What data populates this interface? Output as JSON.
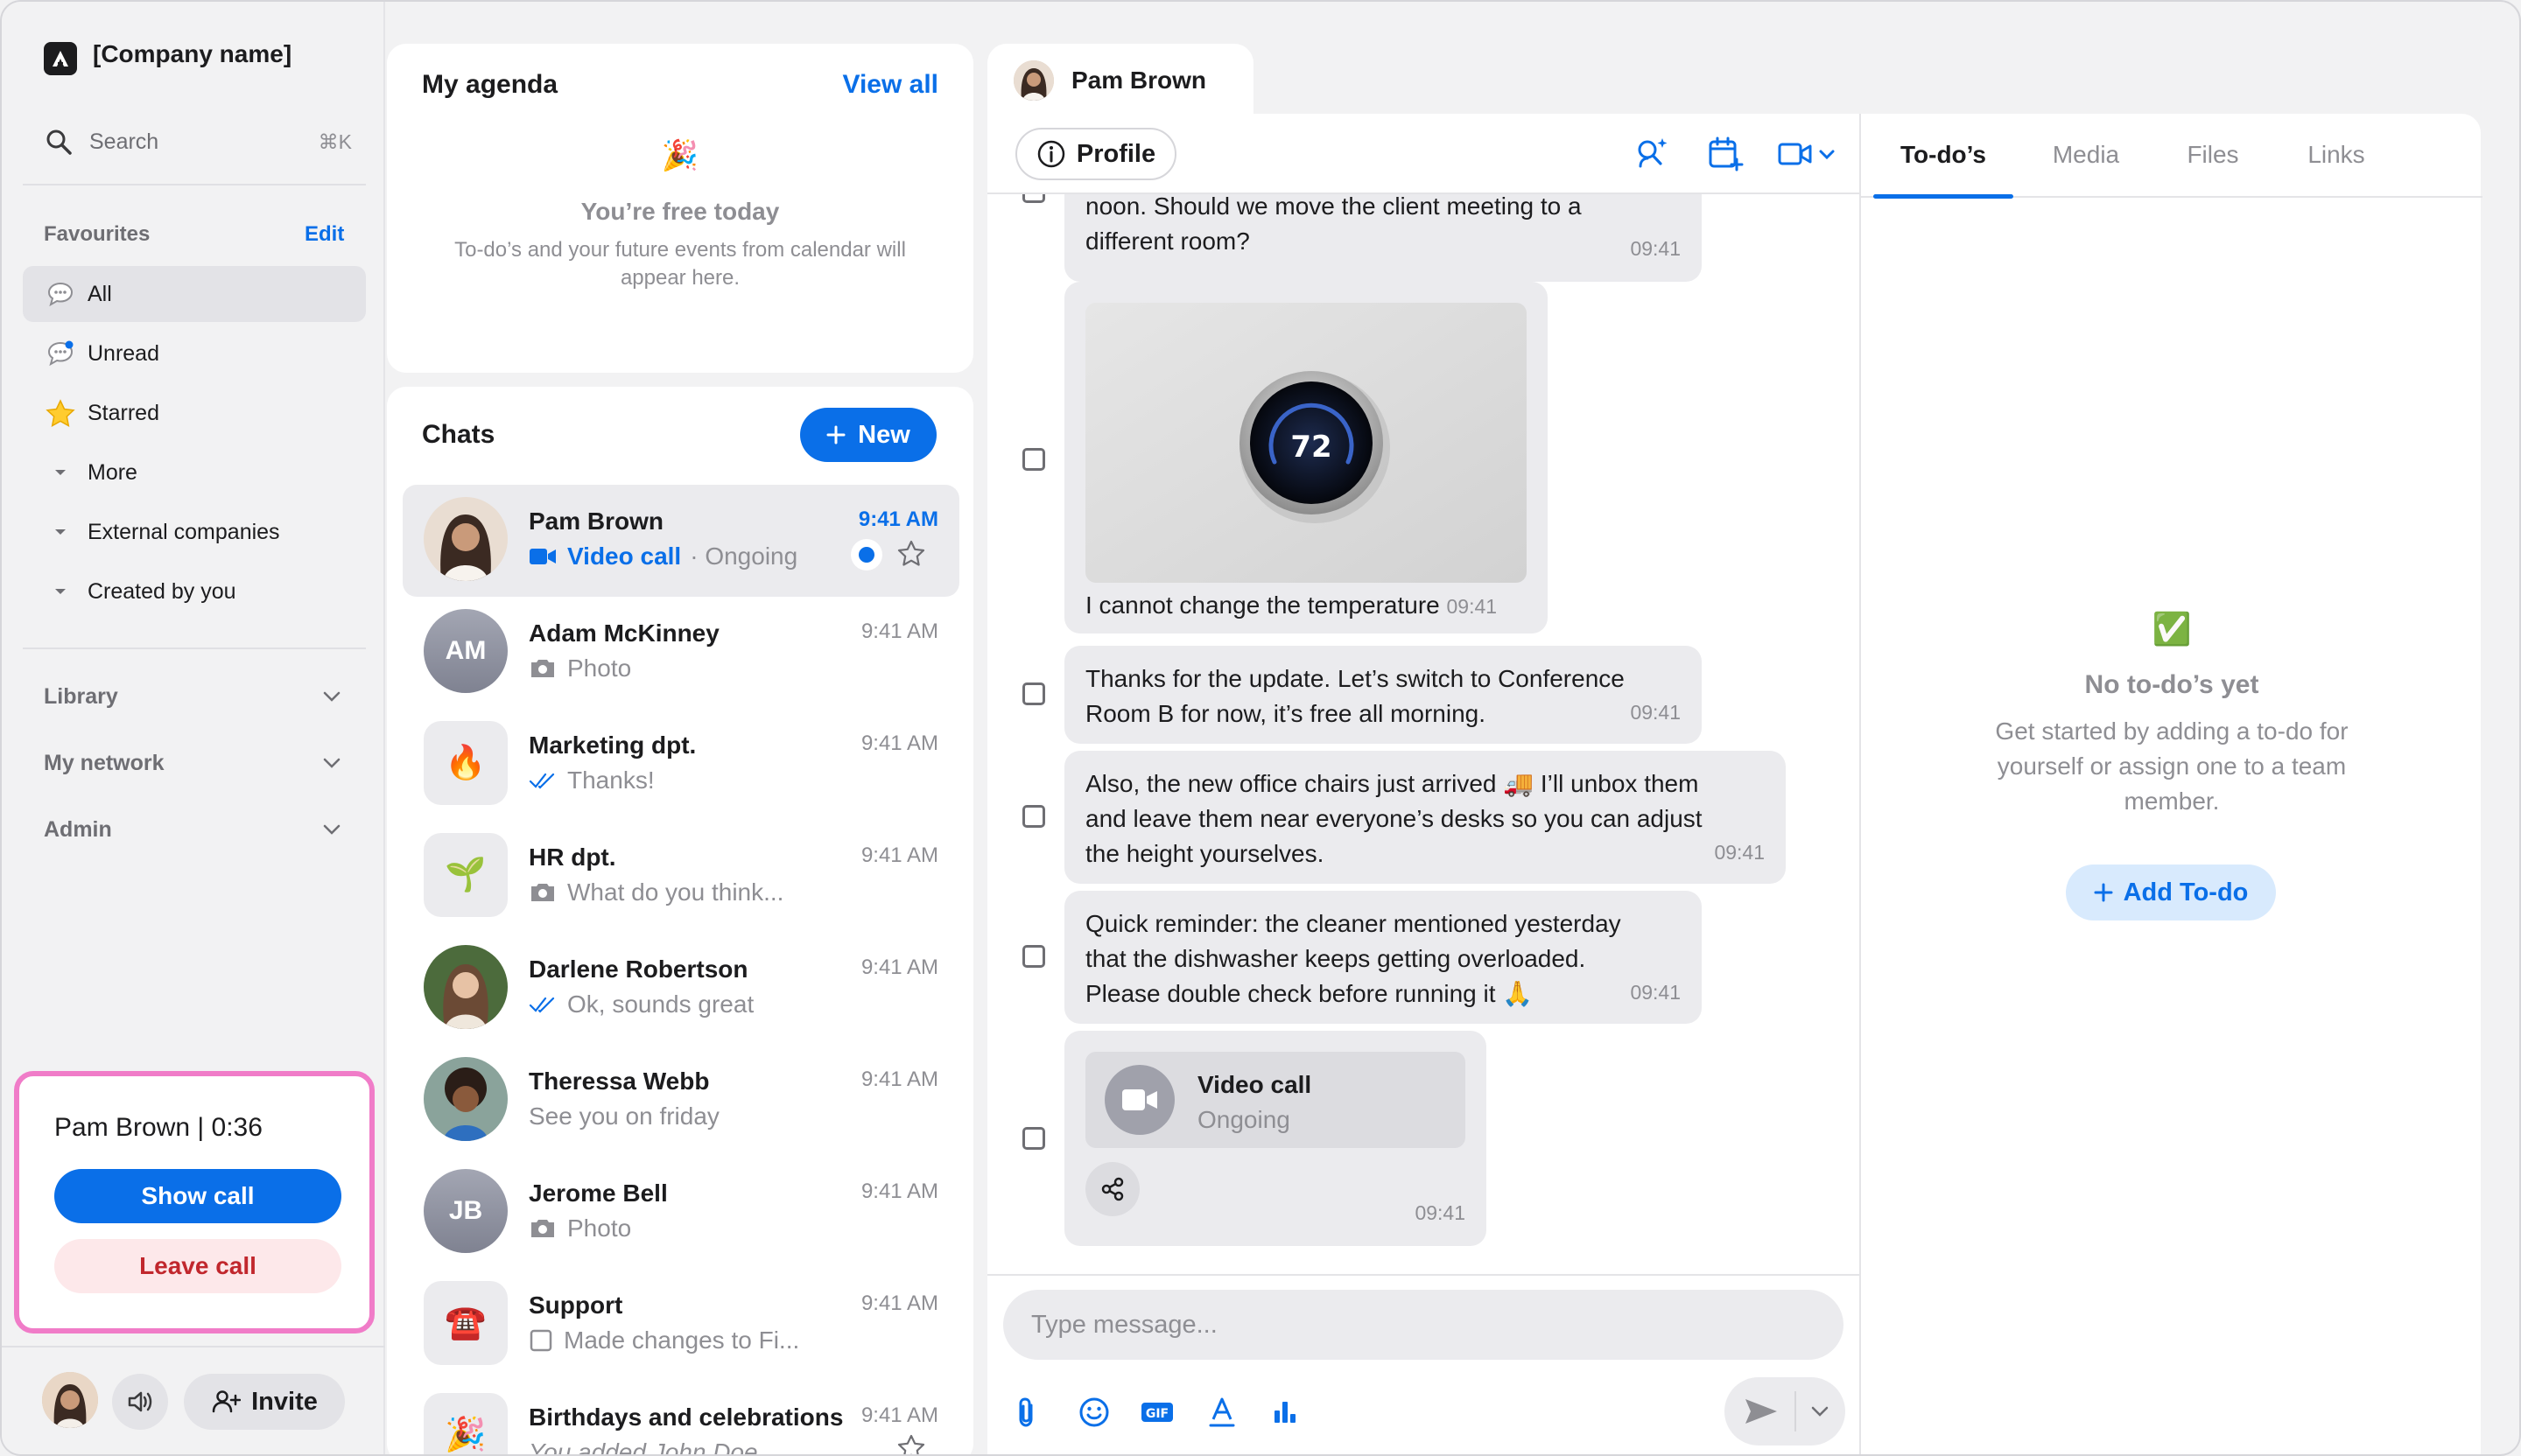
{
  "app": {
    "company": "[Company name]"
  },
  "sidebar": {
    "search_label": "Search",
    "search_shortcut": "⌘K",
    "favourites_title": "Favourites",
    "favourites_edit": "Edit",
    "items": [
      {
        "label": "All",
        "icon": "chat-bubble-icon"
      },
      {
        "label": "Unread",
        "icon": "unread-bubble-icon"
      },
      {
        "label": "Starred",
        "icon": "star-icon"
      },
      {
        "label": "More",
        "icon": "caret-down-icon"
      },
      {
        "label": "External companies",
        "icon": "caret-down-icon"
      },
      {
        "label": "Created by you",
        "icon": "caret-down-icon"
      }
    ],
    "sections": [
      {
        "label": "Library"
      },
      {
        "label": "My network"
      },
      {
        "label": "Admin"
      }
    ],
    "call": {
      "title": "Pam Brown | 0:36",
      "show_label": "Show call",
      "leave_label": "Leave call"
    },
    "invite_label": "Invite"
  },
  "agenda": {
    "title": "My agenda",
    "view_all": "View all",
    "free_icon": "🎉",
    "free_title": "You’re free today",
    "free_desc_1": "To-do’s and your future events from calendar will",
    "free_desc_2": "appear here."
  },
  "chats": {
    "title": "Chats",
    "new_label": "New",
    "rows": [
      {
        "name": "Pam Brown",
        "sub_link": "Video call",
        "sub": "· Ongoing",
        "time": "9:41 AM"
      },
      {
        "name": "Adam McKinney",
        "initials": "AM",
        "sub": "Photo",
        "time": "9:41 AM"
      },
      {
        "name": "Marketing dpt.",
        "emoji": "🔥",
        "sub": "Thanks!",
        "time": "9:41 AM"
      },
      {
        "name": "HR dpt.",
        "emoji": "🌱",
        "sub": "What do you think...",
        "time": "9:41 AM"
      },
      {
        "name": "Darlene Robertson",
        "sub": "Ok, sounds great",
        "time": "9:41 AM"
      },
      {
        "name": "Theressa Webb",
        "sub": "See you on friday",
        "time": "9:41 AM"
      },
      {
        "name": "Jerome Bell",
        "initials": "JB",
        "sub": "Photo",
        "time": "9:41 AM"
      },
      {
        "name": "Support",
        "emoji": "☎️",
        "sub": "Made changes to Fi...",
        "time": "9:41 AM"
      },
      {
        "name": "Birthdays and celebrations",
        "emoji": "🎉",
        "sub": "You added John Doe",
        "time": "9:41 AM"
      }
    ]
  },
  "conversation": {
    "tab_name": "Pam Brown",
    "profile_label": "Profile",
    "messages": [
      {
        "line1": "noon. Should we move the client meeting to a",
        "line2": "different room?",
        "time": "09:41"
      },
      {
        "caption": "I cannot change the temperature",
        "time": "09:41",
        "thermostat": "72"
      },
      {
        "line1": "Thanks for the update. Let’s switch to Conference",
        "line2": "Room B for now, it’s free all morning.",
        "time": "09:41"
      },
      {
        "line1": "Also, the new office chairs just arrived 🚚 I’ll unbox them",
        "line2": "and leave them near everyone’s desks so you can adjust",
        "line3": "the height yourselves.",
        "time": "09:41"
      },
      {
        "line1": "Quick reminder: the cleaner mentioned yesterday",
        "line2": "that the dishwasher keeps getting overloaded.",
        "line3": "Please double check before running it 🙏",
        "time": "09:41"
      },
      {
        "call_title": "Video call",
        "call_status": "Ongoing",
        "time": "09:41"
      }
    ],
    "composer_placeholder": "Type message..."
  },
  "todo_panel": {
    "tabs": [
      "To-do’s",
      "Media",
      "Files",
      "Links"
    ],
    "empty_icon": "✅",
    "empty_title": "No to-do’s yet",
    "empty_desc_1": "Get started by adding a to-do for",
    "empty_desc_2": "yourself or assign one to a team",
    "empty_desc_3": "member.",
    "add_label": "Add To-do"
  },
  "colors": {
    "accent": "#0a6fe8",
    "danger": "#c1272d",
    "highlight": "#f07cc8"
  }
}
